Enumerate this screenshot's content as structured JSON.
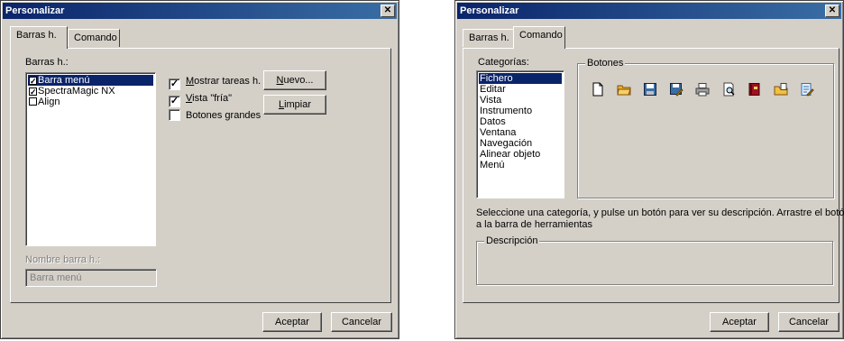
{
  "dialog_left": {
    "title": "Personalizar",
    "close_glyph": "✕",
    "tabs": [
      {
        "label": "Barras h.",
        "active": true
      },
      {
        "label": "Comando",
        "active": false
      }
    ],
    "toolbars_label": "Barras h.:",
    "toolbars": [
      {
        "label": "Barra menú",
        "checked": true,
        "selected": true
      },
      {
        "label": "SpectraMagic NX",
        "checked": true,
        "selected": false
      },
      {
        "label": "Align",
        "checked": false,
        "selected": false
      }
    ],
    "options": [
      {
        "label_ul": "M",
        "label_rest": "ostrar tareas h.",
        "checked": true
      },
      {
        "label_ul": "V",
        "label_rest": "ista \"fría\"",
        "checked": true
      },
      {
        "label_ul": "",
        "label_rest": "Botones grandes",
        "checked": false
      }
    ],
    "new_button": {
      "ul": "N",
      "rest": "uevo..."
    },
    "reset_button": {
      "ul": "L",
      "rest": "impiar"
    },
    "name_label": "Nombre barra h.:",
    "name_value": "Barra menú",
    "ok_label": "Aceptar",
    "cancel_label": "Cancelar"
  },
  "dialog_right": {
    "title": "Personalizar",
    "close_glyph": "✕",
    "tabs": [
      {
        "label": "Barras h.",
        "active": false
      },
      {
        "label": "Comando",
        "active": true
      }
    ],
    "categories_label": "Categorías:",
    "categories": [
      {
        "label": "Fichero",
        "selected": true
      },
      {
        "label": "Editar",
        "selected": false
      },
      {
        "label": "Vista",
        "selected": false
      },
      {
        "label": "Instrumento",
        "selected": false
      },
      {
        "label": "Datos",
        "selected": false
      },
      {
        "label": "Ventana",
        "selected": false
      },
      {
        "label": "Navegación",
        "selected": false
      },
      {
        "label": "Alinear objeto",
        "selected": false
      },
      {
        "label": "Menú",
        "selected": false
      }
    ],
    "buttons_label": "Botones",
    "toolbar_buttons": [
      {
        "icon": "new-file-icon"
      },
      {
        "icon": "open-folder-icon"
      },
      {
        "icon": "save-icon"
      },
      {
        "icon": "save-as-icon"
      },
      {
        "icon": "print-icon"
      },
      {
        "icon": "print-preview-icon"
      },
      {
        "icon": "book-icon"
      },
      {
        "icon": "template-folder-icon"
      },
      {
        "icon": "edit-document-icon"
      }
    ],
    "help_line1": "Seleccione una categoría, y pulse un botón para ver su descripción. Arrastre el botón",
    "help_line2": "a la barra de herramientas",
    "description_label": "Descripción",
    "ok_label": "Aceptar",
    "cancel_label": "Cancelar"
  }
}
